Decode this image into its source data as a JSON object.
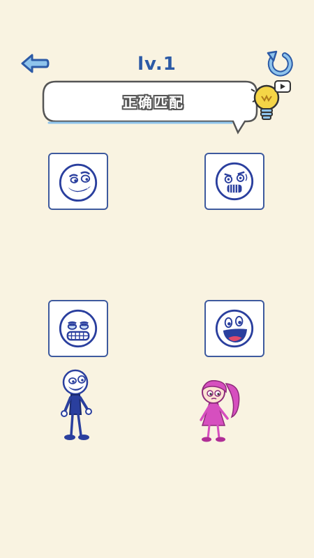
{
  "header": {
    "level_text": "lv.1",
    "back_icon": "back-arrow-icon",
    "restart_icon": "restart-icon"
  },
  "prompt": {
    "text": "正确匹配",
    "hint_icon": "lightbulb-icon",
    "video_badge_icon": "video-play-icon"
  },
  "cards": [
    {
      "icon": "smirk-face-icon"
    },
    {
      "icon": "scared-face-icon"
    },
    {
      "icon": "grimace-face-icon"
    },
    {
      "icon": "laughing-face-icon"
    }
  ],
  "characters": [
    {
      "icon": "blue-boy-character"
    },
    {
      "icon": "pink-girl-character"
    }
  ],
  "colors": {
    "background": "#f9f3e1",
    "accent_blue": "#2c5aa6",
    "card_border": "#3e5a9e",
    "bulb_yellow": "#f5d547",
    "boy_blue": "#2a3f9e",
    "girl_pink": "#d64fbf"
  }
}
